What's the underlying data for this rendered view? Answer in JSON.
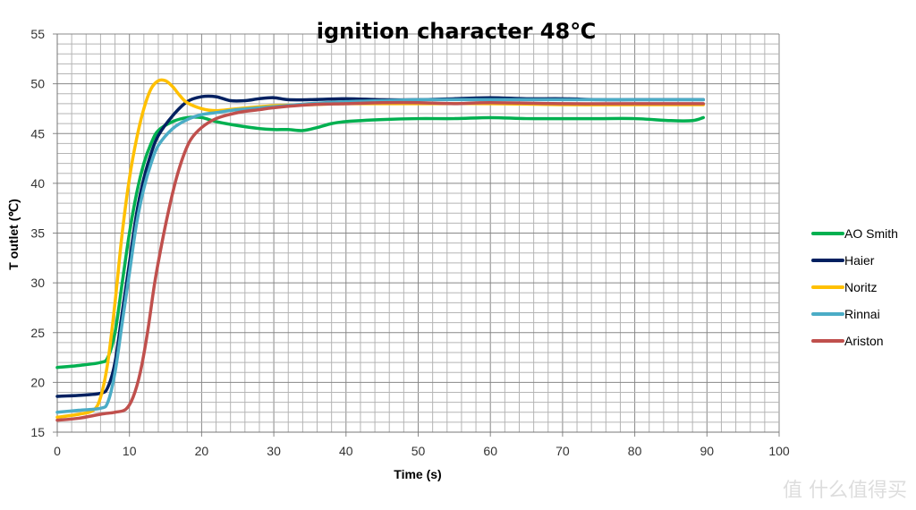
{
  "chart_data": {
    "type": "line",
    "title": "ignition character 48℃",
    "xlabel": "Time (s)",
    "ylabel": "T outlet (℃)",
    "xlim": [
      0,
      100
    ],
    "ylim": [
      15,
      55
    ],
    "xticks": [
      0,
      10,
      20,
      30,
      40,
      50,
      60,
      70,
      80,
      90,
      100
    ],
    "yticks": [
      15,
      20,
      25,
      30,
      35,
      40,
      45,
      50,
      55
    ],
    "x_minor_step": 2,
    "y_minor_step": 1,
    "grid": true,
    "legend_position": "right",
    "series": [
      {
        "name": "AO Smith",
        "color": "#00b050",
        "points": [
          [
            0,
            21.5
          ],
          [
            3,
            21.7
          ],
          [
            6,
            22
          ],
          [
            7,
            22.5
          ],
          [
            8,
            25
          ],
          [
            9,
            30
          ],
          [
            10,
            35
          ],
          [
            11,
            39
          ],
          [
            12,
            42
          ],
          [
            13,
            44
          ],
          [
            14,
            45.3
          ],
          [
            16,
            46.2
          ],
          [
            18,
            46.6
          ],
          [
            20,
            46.6
          ],
          [
            22,
            46.2
          ],
          [
            25,
            45.8
          ],
          [
            28,
            45.5
          ],
          [
            30,
            45.4
          ],
          [
            32,
            45.4
          ],
          [
            34,
            45.3
          ],
          [
            36,
            45.6
          ],
          [
            38,
            46
          ],
          [
            40,
            46.2
          ],
          [
            45,
            46.4
          ],
          [
            50,
            46.5
          ],
          [
            55,
            46.5
          ],
          [
            60,
            46.6
          ],
          [
            65,
            46.5
          ],
          [
            70,
            46.5
          ],
          [
            75,
            46.5
          ],
          [
            80,
            46.5
          ],
          [
            85,
            46.3
          ],
          [
            88,
            46.3
          ],
          [
            89.5,
            46.6
          ]
        ]
      },
      {
        "name": "Haier",
        "color": "#002060",
        "points": [
          [
            0,
            18.6
          ],
          [
            3,
            18.7
          ],
          [
            6,
            18.9
          ],
          [
            7,
            19.5
          ],
          [
            8,
            22
          ],
          [
            9,
            27
          ],
          [
            10,
            32
          ],
          [
            11,
            37
          ],
          [
            12,
            40.5
          ],
          [
            13,
            43
          ],
          [
            14,
            44.8
          ],
          [
            16,
            46.8
          ],
          [
            18,
            48.2
          ],
          [
            20,
            48.7
          ],
          [
            22,
            48.7
          ],
          [
            24,
            48.3
          ],
          [
            26,
            48.3
          ],
          [
            28,
            48.5
          ],
          [
            30,
            48.6
          ],
          [
            32,
            48.4
          ],
          [
            35,
            48.4
          ],
          [
            40,
            48.5
          ],
          [
            45,
            48.4
          ],
          [
            50,
            48.4
          ],
          [
            55,
            48.5
          ],
          [
            60,
            48.6
          ],
          [
            65,
            48.5
          ],
          [
            70,
            48.5
          ],
          [
            75,
            48.4
          ],
          [
            80,
            48.4
          ],
          [
            85,
            48.4
          ],
          [
            89.5,
            48.4
          ]
        ]
      },
      {
        "name": "Noritz",
        "color": "#ffc000",
        "points": [
          [
            0,
            16.5
          ],
          [
            3,
            16.8
          ],
          [
            5,
            17.2
          ],
          [
            6,
            18.5
          ],
          [
            7,
            22
          ],
          [
            8,
            28
          ],
          [
            9,
            35
          ],
          [
            10,
            40.5
          ],
          [
            11,
            44.5
          ],
          [
            12,
            47.5
          ],
          [
            13,
            49.5
          ],
          [
            14,
            50.3
          ],
          [
            15,
            50.3
          ],
          [
            16,
            49.7
          ],
          [
            17,
            48.8
          ],
          [
            18,
            48.1
          ],
          [
            20,
            47.5
          ],
          [
            22,
            47.3
          ],
          [
            25,
            47.5
          ],
          [
            30,
            47.8
          ],
          [
            35,
            47.9
          ],
          [
            40,
            48
          ],
          [
            50,
            48
          ],
          [
            60,
            48
          ],
          [
            70,
            47.9
          ],
          [
            80,
            47.9
          ],
          [
            89.5,
            47.9
          ]
        ]
      },
      {
        "name": "Rinnai",
        "color": "#4bacc6",
        "points": [
          [
            0,
            17
          ],
          [
            3,
            17.2
          ],
          [
            6,
            17.4
          ],
          [
            7,
            18
          ],
          [
            8,
            21
          ],
          [
            9,
            26
          ],
          [
            10,
            31
          ],
          [
            11,
            36
          ],
          [
            12,
            39.5
          ],
          [
            13,
            42
          ],
          [
            14,
            43.8
          ],
          [
            16,
            45.5
          ],
          [
            18,
            46.4
          ],
          [
            20,
            46.9
          ],
          [
            22,
            47.1
          ],
          [
            25,
            47.4
          ],
          [
            30,
            47.7
          ],
          [
            35,
            48
          ],
          [
            40,
            48.2
          ],
          [
            45,
            48.3
          ],
          [
            50,
            48.4
          ],
          [
            55,
            48.4
          ],
          [
            60,
            48.4
          ],
          [
            70,
            48.4
          ],
          [
            80,
            48.4
          ],
          [
            89.5,
            48.4
          ]
        ]
      },
      {
        "name": "Ariston",
        "color": "#c0504d",
        "points": [
          [
            0,
            16.2
          ],
          [
            3,
            16.4
          ],
          [
            6,
            16.8
          ],
          [
            8,
            17
          ],
          [
            9.5,
            17.3
          ],
          [
            10.5,
            18.5
          ],
          [
            11.5,
            21
          ],
          [
            12.5,
            25
          ],
          [
            13.5,
            30
          ],
          [
            14.5,
            34
          ],
          [
            15.5,
            37.5
          ],
          [
            16.5,
            40.5
          ],
          [
            17.5,
            42.8
          ],
          [
            18.5,
            44.4
          ],
          [
            20,
            45.6
          ],
          [
            22,
            46.5
          ],
          [
            25,
            47.1
          ],
          [
            28,
            47.4
          ],
          [
            30,
            47.6
          ],
          [
            35,
            47.9
          ],
          [
            40,
            48
          ],
          [
            45,
            48.1
          ],
          [
            50,
            48.1
          ],
          [
            55,
            48
          ],
          [
            60,
            48.1
          ],
          [
            70,
            48
          ],
          [
            80,
            48
          ],
          [
            89.5,
            48
          ]
        ]
      }
    ]
  },
  "watermark": "值 什么值得买"
}
